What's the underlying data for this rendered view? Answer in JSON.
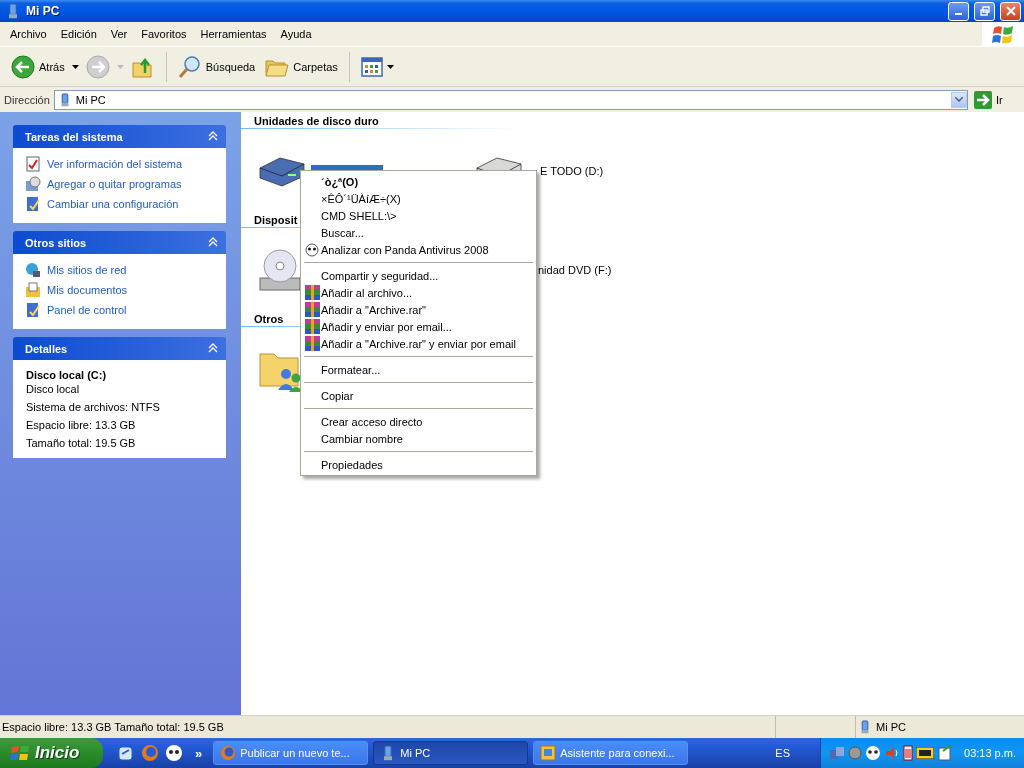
{
  "window": {
    "title": "Mi PC"
  },
  "menu_bar": [
    "Archivo",
    "Edición",
    "Ver",
    "Favoritos",
    "Herramientas",
    "Ayuda"
  ],
  "toolbar": {
    "back": "Atrás",
    "search": "Búsqueda",
    "folders": "Carpetas"
  },
  "address_bar": {
    "label": "Dirección",
    "value": "Mi PC",
    "go": "Ir"
  },
  "side_panels": [
    {
      "title": "Tareas del sistema",
      "expanded": true,
      "links": [
        "Ver información del sistema",
        "Agregar o quitar programas",
        "Cambiar una configuración"
      ]
    },
    {
      "title": "Otros sitios",
      "expanded": true,
      "links": [
        "Mis sitios de red",
        "Mis documentos",
        "Panel de control"
      ]
    }
  ],
  "details": {
    "title": "Detalles",
    "expanded": true,
    "name": "Disco local (C:)",
    "lines": [
      "Disco local",
      "Sistema de archivos: NTFS",
      "Espacio libre: 13.3 GB",
      "Tamaño total: 19.5 GB"
    ]
  },
  "groups": [
    {
      "heading": "Unidades de disco duro",
      "items": [
        {
          "kind": "hard-disk",
          "selected": true
        },
        {
          "kind": "gray-disk",
          "selected": false,
          "label": "E TODO (D:)"
        }
      ]
    },
    {
      "heading": "Disposit",
      "items": [
        {
          "kind": "optical-drive"
        },
        {
          "kind": "covered",
          "selected": false,
          "label": "nidad DVD (F:)"
        }
      ]
    },
    {
      "heading": "Otros",
      "items": [
        {
          "kind": "shared-folder"
        }
      ]
    }
  ],
  "context_menu": [
    {
      "kind": "plain",
      "label": "´ò¿ª(O)",
      "default": true
    },
    {
      "kind": "plain",
      "label": "×ÊÔ´¹ÜÀíÆ÷(X)",
      "default": false
    },
    {
      "kind": "plain",
      "label": "CMD SHELL:\\>",
      "default": false
    },
    {
      "kind": "plain",
      "label": "Buscar...",
      "default": false
    },
    {
      "kind": "panda",
      "label": "Analizar con Panda Antivirus 2008",
      "default": false
    },
    {
      "kind": "separator"
    },
    {
      "kind": "plain",
      "label": "Compartir y seguridad...",
      "default": false
    },
    {
      "kind": "archive",
      "label": "Añadir al archivo...",
      "default": false
    },
    {
      "kind": "archive",
      "label": "Añadir a \"Archive.rar\"",
      "default": false
    },
    {
      "kind": "archive",
      "label": "Añadir y enviar por email...",
      "default": false
    },
    {
      "kind": "archive",
      "label": "Añadir a \"Archive.rar\" y enviar por email",
      "default": false
    },
    {
      "kind": "separator"
    },
    {
      "kind": "plain",
      "label": "Formatear...",
      "default": false
    },
    {
      "kind": "separator"
    },
    {
      "kind": "plain",
      "label": "Copiar",
      "default": false
    },
    {
      "kind": "separator"
    },
    {
      "kind": "plain",
      "label": "Crear acceso directo",
      "default": false
    },
    {
      "kind": "plain",
      "label": "Cambiar nombre",
      "default": false
    },
    {
      "kind": "separator"
    },
    {
      "kind": "plain",
      "label": "Propiedades",
      "default": false
    }
  ],
  "status_bar": {
    "left": "Espacio libre: 13.3 GB Tamaño total: 19.5 GB",
    "right": "Mi PC"
  },
  "taskbar": {
    "start": "Inicio",
    "more": "»",
    "tasks": [
      {
        "kind": "browser",
        "label": "Publicar un nuevo te...",
        "selected": false
      },
      {
        "kind": "computer",
        "label": "Mi PC",
        "selected": true
      },
      {
        "kind": "wizard",
        "label": "Asistente para conexi...",
        "selected": false
      }
    ],
    "language": "ES",
    "clock": "03:13 p.m."
  }
}
